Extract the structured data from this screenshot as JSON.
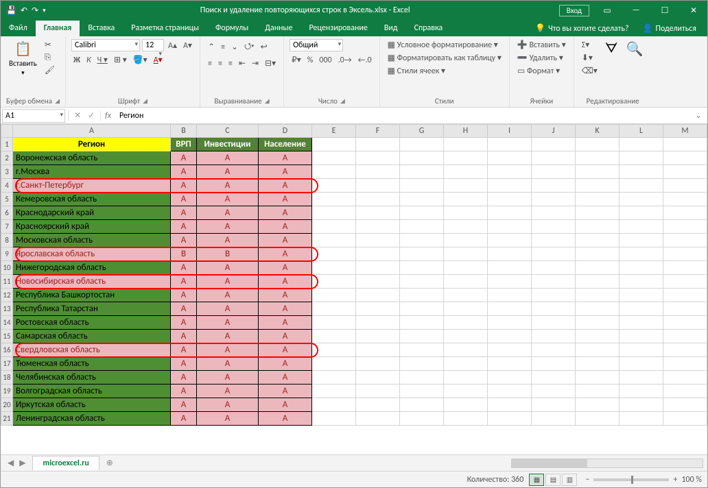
{
  "title": "Поиск и удаление повторяющихся строк в Эксель.xlsx  -  Excel",
  "signin": "Вход",
  "tabs": [
    "Файл",
    "Главная",
    "Вставка",
    "Разметка страницы",
    "Формулы",
    "Данные",
    "Рецензирование",
    "Вид",
    "Справка"
  ],
  "active_tab": "Главная",
  "tellme": "Что вы хотите сделать?",
  "share": "Поделиться",
  "ribbon": {
    "clipboard": {
      "label": "Буфер обмена",
      "paste": "Вставить"
    },
    "font": {
      "label": "Шрифт",
      "name": "Calibri",
      "size": "12"
    },
    "align": {
      "label": "Выравнивание"
    },
    "number": {
      "label": "Число",
      "format": "Общий"
    },
    "styles": {
      "label": "Стили",
      "cond": "Условное форматирование",
      "table": "Форматировать как таблицу",
      "cell": "Стили ячеек"
    },
    "cells": {
      "label": "Ячейки",
      "insert": "Вставить",
      "delete": "Удалить",
      "format": "Формат"
    },
    "editing": {
      "label": "Редактирование"
    }
  },
  "namebox": "A1",
  "formula": "Регион",
  "columns": [
    "A",
    "B",
    "C",
    "D",
    "E",
    "F",
    "G",
    "H",
    "I",
    "J",
    "K",
    "L",
    "M"
  ],
  "headers": {
    "region": "Регион",
    "vrp": "ВРП",
    "inv": "Инвестиции",
    "pop": "Население"
  },
  "rows": [
    {
      "n": 2,
      "region": "Воронежская область",
      "v": [
        "А",
        "А",
        "А"
      ],
      "hl": false
    },
    {
      "n": 3,
      "region": "г.Москва",
      "v": [
        "А",
        "А",
        "А"
      ],
      "hl": false
    },
    {
      "n": 4,
      "region": "г.Санкт-Петербург",
      "v": [
        "А",
        "А",
        "А"
      ],
      "hl": true
    },
    {
      "n": 5,
      "region": "Кемеровская область",
      "v": [
        "А",
        "А",
        "А"
      ],
      "hl": false
    },
    {
      "n": 6,
      "region": "Краснодарский край",
      "v": [
        "А",
        "А",
        "А"
      ],
      "hl": false
    },
    {
      "n": 7,
      "region": "Красноярский край",
      "v": [
        "А",
        "А",
        "А"
      ],
      "hl": false
    },
    {
      "n": 8,
      "region": "Московская область",
      "v": [
        "А",
        "А",
        "А"
      ],
      "hl": false
    },
    {
      "n": 9,
      "region": "Ярославская область",
      "v": [
        "B",
        "B",
        "А"
      ],
      "hl": true
    },
    {
      "n": 10,
      "region": "Нижегородская область",
      "v": [
        "А",
        "А",
        "А"
      ],
      "hl": false
    },
    {
      "n": 11,
      "region": "Новосибирская область",
      "v": [
        "А",
        "А",
        "А"
      ],
      "hl": true
    },
    {
      "n": 12,
      "region": "Республика Башкортостан",
      "v": [
        "А",
        "А",
        "А"
      ],
      "hl": false
    },
    {
      "n": 13,
      "region": "Республика Татарстан",
      "v": [
        "А",
        "А",
        "А"
      ],
      "hl": false
    },
    {
      "n": 14,
      "region": "Ростовская область",
      "v": [
        "А",
        "А",
        "А"
      ],
      "hl": false
    },
    {
      "n": 15,
      "region": "Самарская область",
      "v": [
        "А",
        "А",
        "А"
      ],
      "hl": false
    },
    {
      "n": 16,
      "region": "Свердловская область",
      "v": [
        "А",
        "А",
        "А"
      ],
      "hl": true
    },
    {
      "n": 17,
      "region": "Тюменская область",
      "v": [
        "А",
        "А",
        "А"
      ],
      "hl": false
    },
    {
      "n": 18,
      "region": "Челябинская область",
      "v": [
        "А",
        "А",
        "А"
      ],
      "hl": false
    },
    {
      "n": 19,
      "region": "Волгоградская область",
      "v": [
        "А",
        "А",
        "А"
      ],
      "hl": false
    },
    {
      "n": 20,
      "region": "Иркутская область",
      "v": [
        "А",
        "А",
        "А"
      ],
      "hl": false
    },
    {
      "n": 21,
      "region": "Ленинградская область",
      "v": [
        "А",
        "А",
        "А"
      ],
      "hl": false
    }
  ],
  "sheet_tab": "microexcel.ru",
  "status": {
    "count_label": "Количество:",
    "count": "360",
    "zoom": "100 %"
  }
}
